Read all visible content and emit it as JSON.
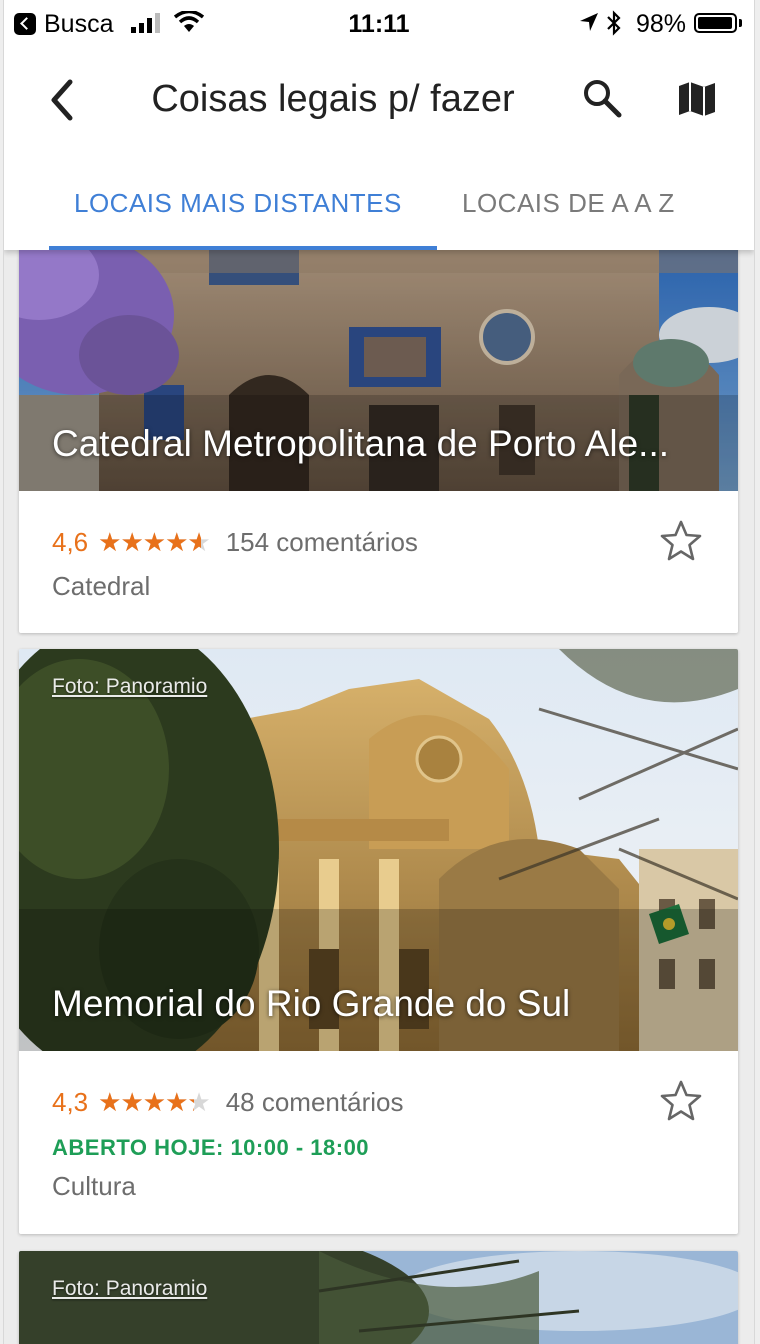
{
  "status_bar": {
    "carrier": "Busca",
    "time": "11:11",
    "battery": "98%",
    "battery_level": 0.98
  },
  "header": {
    "title": "Coisas legais p/ fazer",
    "icons": [
      "back-arrow-icon",
      "search-icon",
      "map-icon"
    ]
  },
  "tabs": [
    {
      "label": "LOCAIS MAIS DISTANTES",
      "active": true
    },
    {
      "label": "LOCAIS DE A A Z",
      "active": false
    }
  ],
  "places": [
    {
      "name": "Catedral Metropolitana de Porto Ale...",
      "rating": "4,6",
      "rating_value": 4.6,
      "reviews": "154 comentários",
      "category": "Catedral",
      "photo_credit": "",
      "hours": ""
    },
    {
      "name": "Memorial do Rio Grande do Sul",
      "rating": "4,3",
      "rating_value": 4.3,
      "reviews": "48 comentários",
      "category": "Cultura",
      "photo_credit": "Foto: Panoramio",
      "hours": "ABERTO HOJE: 10:00 - 18:00"
    },
    {
      "photo_credit": "Foto: Panoramio"
    }
  ],
  "colors": {
    "accent_blue": "#3f7fd6",
    "rating_orange": "#e8711a",
    "open_green": "#1e9e57"
  }
}
